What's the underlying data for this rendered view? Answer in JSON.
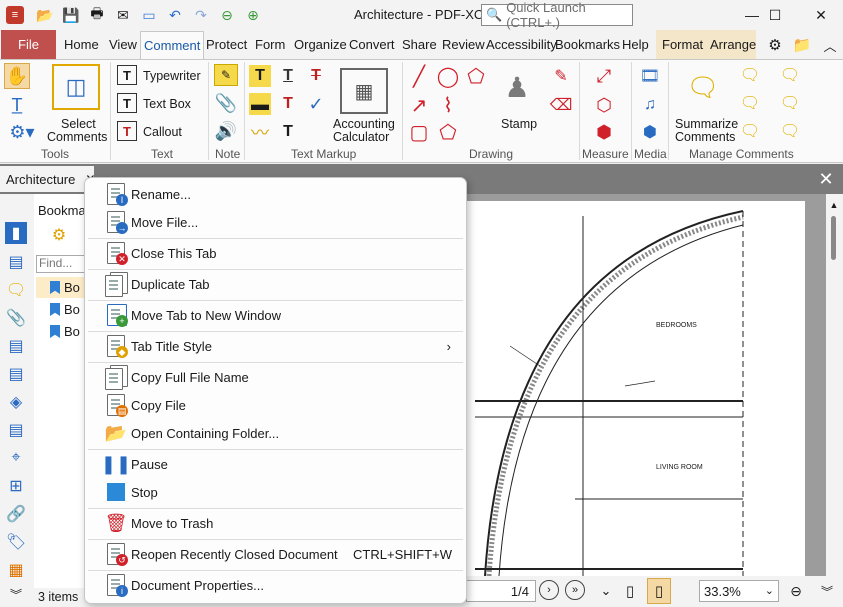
{
  "window": {
    "title": "Architecture - PDF-XC...",
    "quick_launch_placeholder": "Quick Launch (CTRL+.)"
  },
  "ribbon_tabs": {
    "file": "File",
    "home": "Home",
    "view": "View",
    "comment": "Comment",
    "protect": "Protect",
    "form": "Form",
    "organize": "Organize",
    "convert": "Convert",
    "share": "Share",
    "review": "Review",
    "accessibility": "Accessibility",
    "bookmarks": "Bookmarks",
    "help": "Help",
    "format": "Format",
    "arrange": "Arrange"
  },
  "ribbon": {
    "select_comments_line1": "Select",
    "select_comments_line2": "Comments",
    "typewriter": "Typewriter",
    "text_box": "Text Box",
    "callout": "Callout",
    "accounting_calc_line1": "Accounting",
    "accounting_calc_line2": "Calculator",
    "stamp": "Stamp",
    "summarize_line1": "Summarize",
    "summarize_line2": "Comments",
    "groups": {
      "tools": "Tools",
      "text": "Text",
      "note": "Note",
      "text_markup": "Text Markup",
      "drawing": "Drawing",
      "measure": "Measure",
      "media": "Media",
      "manage_comments": "Manage Comments"
    }
  },
  "doc_tab": {
    "label": "Architecture"
  },
  "bookmarks_panel": {
    "title": "Bookmar",
    "find_placeholder": "Find...",
    "rows": [
      "Bo",
      "Bo",
      "Bo"
    ],
    "status": "3 items"
  },
  "navigation": {
    "page": "1/4",
    "zoom": "33.3%"
  },
  "drawing_labels": {
    "bedrooms": "BEDROOMS",
    "living_room": "LIVING ROOM"
  },
  "context_menu": {
    "rename": "Rename...",
    "move_file": "Move File...",
    "close_tab": "Close This Tab",
    "duplicate_tab": "Duplicate Tab",
    "move_new_window": "Move Tab to New Window",
    "tab_title_style": "Tab Title Style",
    "copy_full_name": "Copy Full File Name",
    "copy_file": "Copy File",
    "open_folder": "Open Containing Folder...",
    "pause": "Pause",
    "stop": "Stop",
    "move_trash": "Move to Trash",
    "reopen_closed": "Reopen Recently Closed Document",
    "reopen_shortcut": "CTRL+SHIFT+W",
    "doc_properties": "Document Properties..."
  }
}
